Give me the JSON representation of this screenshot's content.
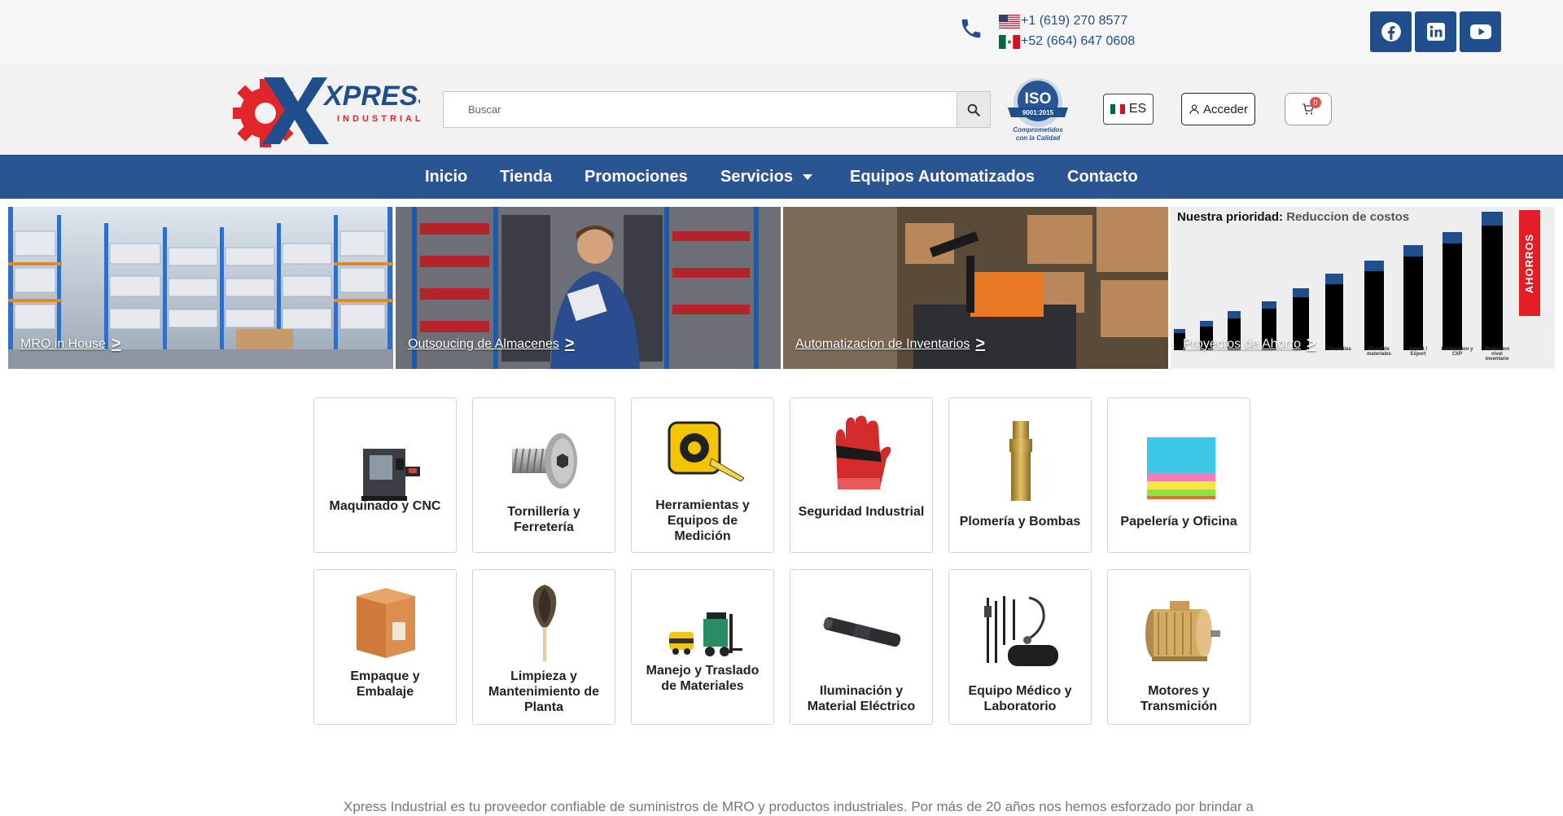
{
  "topbar": {
    "phones": [
      {
        "country": "us",
        "number": "+1 (619) 270 8577"
      },
      {
        "country": "mx",
        "number": "+52 (664) 647 0608"
      }
    ],
    "social": [
      "facebook-icon",
      "linkedin-icon",
      "youtube-icon"
    ],
    "accent_color": "#1f4e8c"
  },
  "header": {
    "logo_text": "XPRESS",
    "logo_sub": "INDUSTRIAL",
    "search_placeholder": "Buscar",
    "iso_seal_text": "ISO",
    "iso_seal_number": "9001:2015",
    "iso_seal_caption_1": "Comprometidos",
    "iso_seal_caption_2": "con la Calidad",
    "language": "ES",
    "login_label": "Acceder",
    "cart_count": "0"
  },
  "nav": {
    "items": [
      "Inicio",
      "Tienda",
      "Promociones",
      "Servicios",
      "Equipos Automatizados",
      "Contacto"
    ],
    "bg_color": "#2a5593"
  },
  "banners": [
    {
      "label": "MRO in House",
      "arrow": ">"
    },
    {
      "label": "Outsoucing de Almacenes",
      "arrow": ">"
    },
    {
      "label": "Automatizacion de Inventarios",
      "arrow": ">"
    },
    {
      "label": "Proyectos de Ahorro",
      "arrow": ">",
      "title_bold": "Nuestra prioridad:",
      "title_sub": "Reduccion de costos",
      "side_label": "AHORROS",
      "bar_labels": [
        "Garantias",
        "Costo de materiales",
        "Import / Export",
        "Facturacion y CXP",
        "Reduccion nivel inventario"
      ]
    }
  ],
  "categories": [
    {
      "label": "Maquinado y CNC",
      "icon": "cnc-machine-icon"
    },
    {
      "label": "Tornillería y Ferretería",
      "icon": "screw-icon"
    },
    {
      "label": "Herramientas y Equipos de Medición",
      "icon": "tape-measure-icon"
    },
    {
      "label": "Seguridad Industrial",
      "icon": "glove-icon"
    },
    {
      "label": "Plomería y Bombas",
      "icon": "brass-fitting-icon"
    },
    {
      "label": "Papelería y Oficina",
      "icon": "sticky-notes-icon"
    },
    {
      "label": "Empaque y Embalaje",
      "icon": "cardboard-box-icon"
    },
    {
      "label": "Limpieza y Mantenimiento de Planta",
      "icon": "feather-duster-icon"
    },
    {
      "label": "Manejo y Traslado de Materiales",
      "icon": "forklift-icon"
    },
    {
      "label": "Iluminación y Material Eléctrico",
      "icon": "flashlight-icon"
    },
    {
      "label": "Equipo Médico y Laboratorio",
      "icon": "medical-kit-icon"
    },
    {
      "label": "Motores y Transmición",
      "icon": "electric-motor-icon"
    }
  ],
  "intro_text": "Xpress Industrial es tu proveedor confiable de suministros de MRO y productos industriales. Por más de 20 años nos hemos esforzado por brindar a"
}
